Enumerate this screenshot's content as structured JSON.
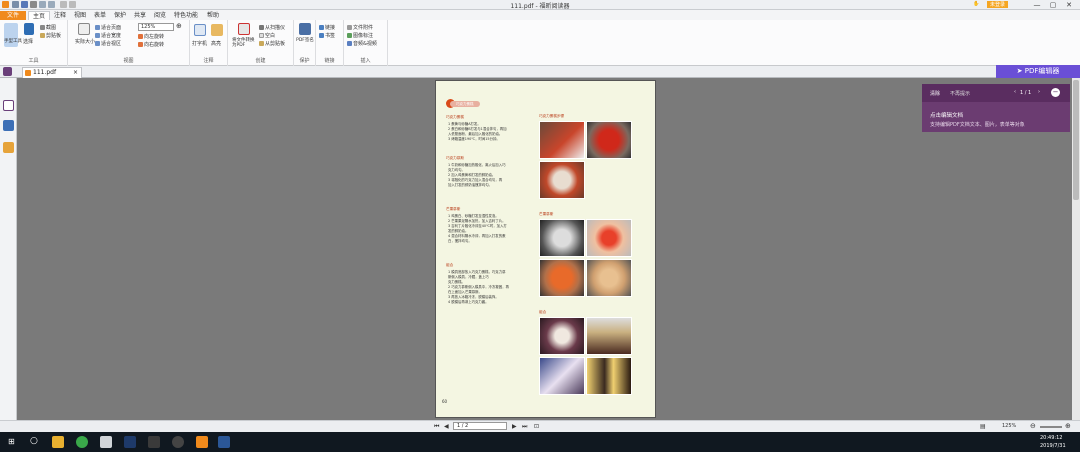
{
  "app": {
    "title": "111.pdf - 福昕阅读器",
    "login": "未登录",
    "search_placeholder": "查找"
  },
  "menu_tabs": [
    "文件",
    "主页",
    "注释",
    "视图",
    "表单",
    "保护",
    "共享",
    "阅览",
    "特色功能",
    "帮助"
  ],
  "ribbon": {
    "groups": [
      {
        "label": "工具",
        "items": [
          "手型工具",
          "选择",
          "截图",
          "剪贴板"
        ]
      },
      {
        "label": "视图",
        "items": [
          "实际大小",
          "适合页面",
          "适合宽度",
          "适合视区",
          "向左旋转",
          "向右旋转",
          "125%"
        ]
      },
      {
        "label": "注释",
        "items": [
          "打字机",
          "高亮"
        ]
      },
      {
        "label": "创建",
        "items": [
          "将文件转换为PDF",
          "从扫描仪",
          "空白",
          "从剪贴板"
        ]
      },
      {
        "label": "保护",
        "items": [
          "PDF签名"
        ]
      },
      {
        "label": "链接",
        "items": [
          "链接",
          "书签"
        ]
      },
      {
        "label": "插入",
        "items": [
          "文件附件",
          "图像标注",
          "音频&视频"
        ]
      }
    ]
  },
  "doc_tab": "111.pdf",
  "pdf_editor_button": "PDF编辑器",
  "page": {
    "badge": "巧克力蛋糕",
    "page_number": "60",
    "sections_left": [
      {
        "title": "巧克力蛋糕",
        "lines": [
          "1 蛋黄与砂糖A打发。",
          "2 蛋白和砂糖B打发与1混合拌匀，再加",
          "  入低筋面粉、最后加入融化的奶油。",
          "3 烤箱温度190℃，时间15分钟。"
        ]
      },
      {
        "title": "巧克力慕斯",
        "lines": [
          "1 牛奶和砂糖加热融化，离火后加入巧",
          "  克力均匀。",
          "2 加入鸡蛋黄和打发的鲜奶油。",
          "3 将融化的巧克力加入混合均匀，再",
          "  加入打发的鲜奶油搅拌均匀。"
        ]
      },
      {
        "title": "芒果慕斯",
        "lines": [
          "1 鸡蛋白、砂糖打发至湿性发泡。",
          "2 芒果果泥隔水加热，加入吉利丁片。",
          "3 吉利丁片融化冷却至40℃时，加入打",
          "  发的鲜奶油。",
          "4 混合材料隔水冷却，再加入打发的蛋",
          "  白，搅拌均匀。"
        ]
      },
      {
        "title": "组合",
        "lines": [
          "1 模具底部放入巧克力蛋糕，巧克力慕",
          "  斯倒入模具，冷藏，盖上巧",
          "  克力蛋糕。",
          "2 巧克力慕斯倒入模具中，冷冻凝固，再",
          "  在上面加入芒果慕斯。",
          "3 再放入冰箱冷冻，脱模后装饰。",
          "4 脱模后再淋上巧克力酱。"
        ]
      }
    ],
    "sections_right": [
      "巧克力蛋糕步骤",
      "芒果慕斯",
      "组合"
    ]
  },
  "right_panel": {
    "close": "清除",
    "no_prompt": "不再提示",
    "pager": "1 / 1",
    "link_text": "点击编辑文档",
    "desc": "支持编辑PDF文档文本、图片，表单等对象"
  },
  "statusbar": {
    "page_box": "1 / 2",
    "zoom": "125%"
  },
  "taskbar": {
    "time": "20:49:12",
    "date": "2019/7/31"
  },
  "colors": {
    "accent": "#f08a1c",
    "panel": "#6b3c71",
    "editor": "#6a4fd6",
    "taskbar": "#101820"
  }
}
